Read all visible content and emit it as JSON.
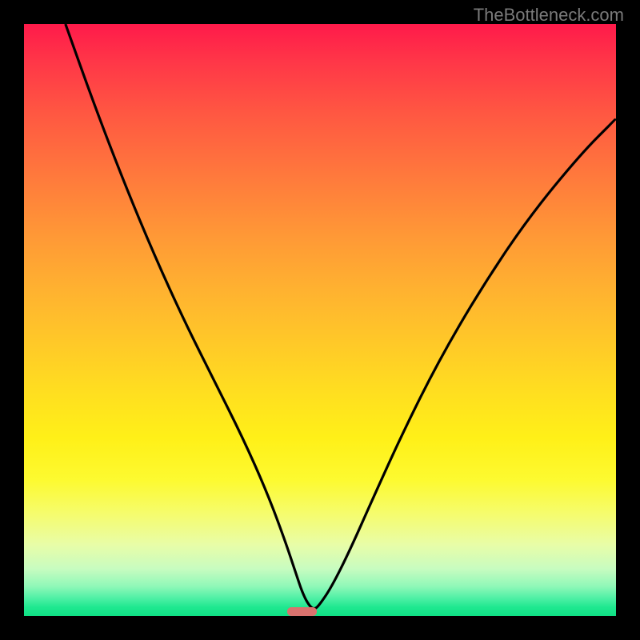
{
  "watermark": "TheBottleneck.com",
  "chart_data": {
    "type": "line",
    "title": "",
    "xlabel": "",
    "ylabel": "",
    "x_range": [
      0,
      100
    ],
    "y_range": [
      0,
      100
    ],
    "series": [
      {
        "name": "curve",
        "x": [
          7,
          12,
          17,
          22,
          27,
          32,
          37,
          41,
          44,
          46,
          47,
          48,
          49,
          50,
          52,
          55,
          59,
          64,
          70,
          77,
          85,
          94,
          100
        ],
        "y": [
          100,
          86,
          73,
          61,
          50,
          40,
          30,
          21,
          13,
          7,
          4,
          2,
          1,
          2,
          5,
          11,
          20,
          31,
          43,
          55,
          67,
          78,
          84
        ]
      }
    ],
    "marker": {
      "x_center": 47,
      "width_pct": 5,
      "color": "#d9726e"
    },
    "background_gradient": {
      "top": "#ff1a4a",
      "mid": "#ffde20",
      "bottom": "#10e085"
    },
    "grid": false,
    "legend": false
  }
}
